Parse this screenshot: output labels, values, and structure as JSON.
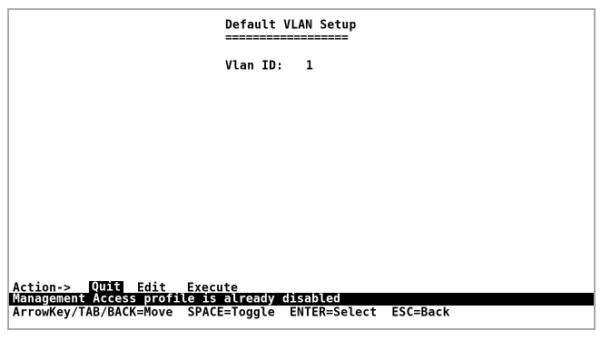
{
  "screen": {
    "title": "Default VLAN Setup",
    "title_rule": "==================",
    "vlan_id": {
      "label": "Vlan ID:",
      "value": "1"
    }
  },
  "action_bar": {
    "label": "Action->",
    "items": [
      "Quit",
      "Edit",
      "Execute"
    ],
    "selected": "Quit"
  },
  "status_message": "Management Access profile is already disabled",
  "help_line": "ArrowKey/TAB/BACK=Move  SPACE=Toggle  ENTER=Select  ESC=Back",
  "colors": {
    "background": "#ffffff",
    "text": "#000000",
    "highlight_bg": "#000000",
    "highlight_text": "#ffffff"
  }
}
